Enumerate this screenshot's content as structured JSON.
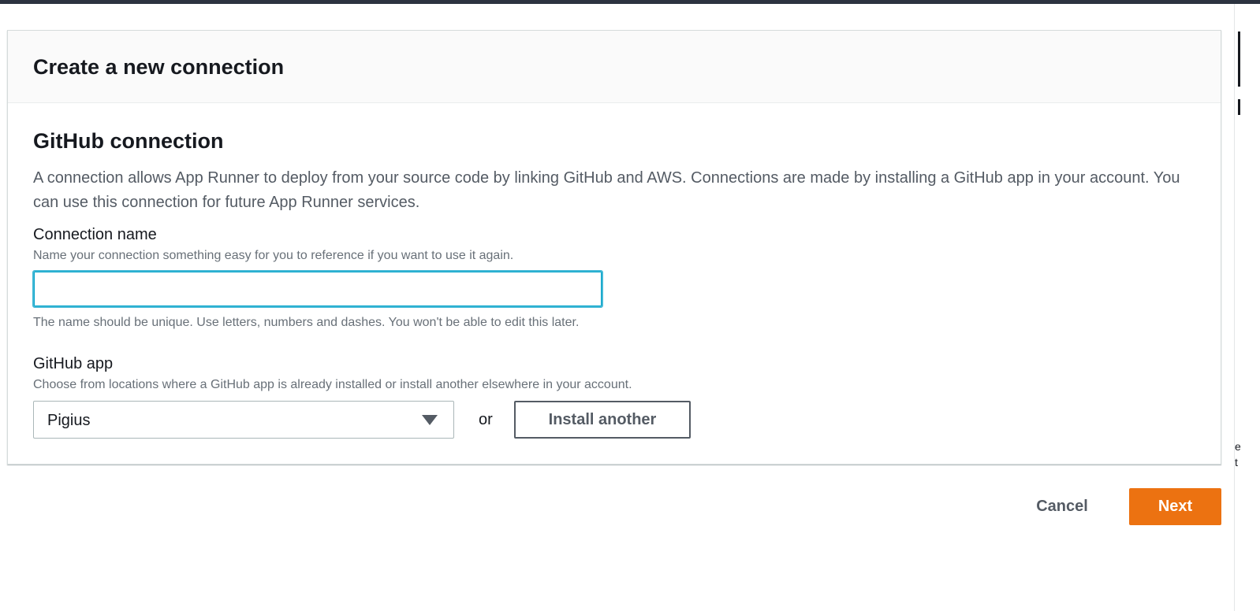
{
  "dialog": {
    "title": "Create a new connection"
  },
  "section": {
    "title": "GitHub connection",
    "description": "A connection allows App Runner to deploy from your source code by linking GitHub and AWS. Connections are made by installing a GitHub app in your account. You can use this connection for future App Runner services."
  },
  "connection_name": {
    "label": "Connection name",
    "hint": "Name your connection something easy for you to reference if you want to use it again.",
    "value": "",
    "constraint": "The name should be unique. Use letters, numbers and dashes. You won't be able to edit this later."
  },
  "github_app": {
    "label": "GitHub app",
    "hint": "Choose from locations where a GitHub app is already installed or install another elsewhere in your account.",
    "selected": "Pigius",
    "or_text": "or",
    "install_label": "Install another"
  },
  "footer": {
    "cancel_label": "Cancel",
    "next_label": "Next"
  },
  "colors": {
    "primary": "#ec7211",
    "focus_ring": "#00a1c9",
    "text": "#16191f",
    "secondary_text": "#545b64"
  },
  "icons": {
    "select_caret": "caret-down-icon"
  }
}
